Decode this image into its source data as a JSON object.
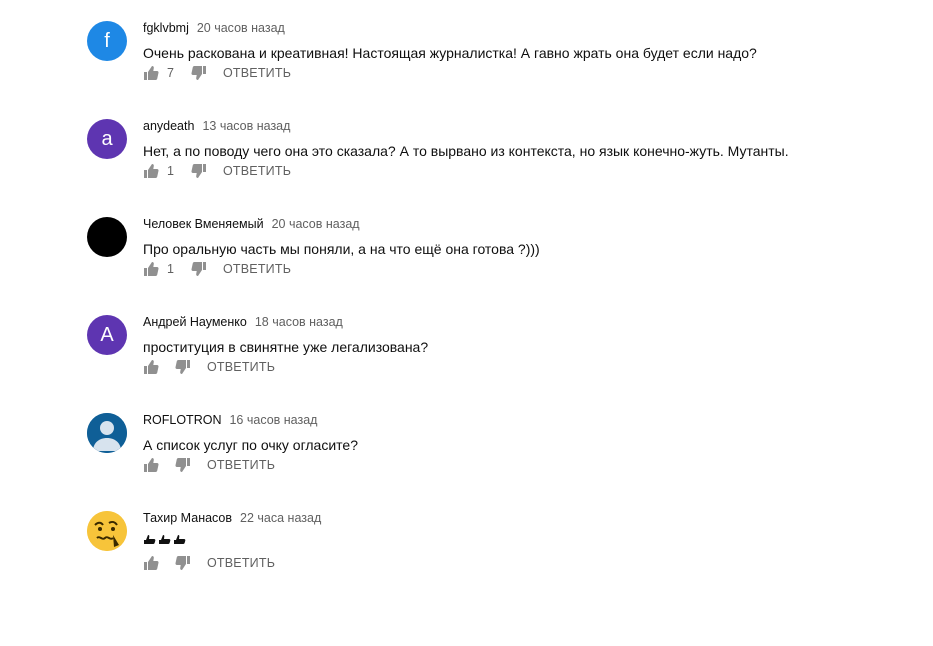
{
  "comments": [
    {
      "author": "fgklvbmj",
      "time": "20 часов назад",
      "text": "Очень раскована и креативная! Настоящая журналистка! А гавно жрать она будет если надо?",
      "likes": "7",
      "reply_label": "ОТВЕТИТЬ",
      "avatar": {
        "letter": "f",
        "color": "#1e88e5",
        "kind": "letter"
      }
    },
    {
      "author": "anydeath",
      "time": "13 часов назад",
      "text": "Нет, а по поводу чего она это сказала? А то вырвано из контекста, но язык конечно-жуть. Мутанты.",
      "likes": "1",
      "reply_label": "ОТВЕТИТЬ",
      "avatar": {
        "letter": "a",
        "color": "#5e35b1",
        "kind": "letter"
      }
    },
    {
      "author": "Человек Вменяемый",
      "time": "20 часов назад",
      "text": "Про оральную часть мы поняли, а на что ещё она готова ?)))",
      "likes": "1",
      "reply_label": "ОТВЕТИТЬ",
      "avatar": {
        "letter": "",
        "color": "#000000",
        "kind": "solid"
      }
    },
    {
      "author": "Андрей Науменко",
      "time": "18 часов назад",
      "text": "проституция в свинятне уже легализована?",
      "likes": "",
      "reply_label": "ОТВЕТИТЬ",
      "avatar": {
        "letter": "А",
        "color": "#5e35b1",
        "kind": "letter"
      }
    },
    {
      "author": "ROFLOTRON",
      "time": "16 часов назад",
      "text": "А список услуг по очку огласите?",
      "likes": "",
      "reply_label": "ОТВЕТИТЬ",
      "avatar": {
        "letter": "",
        "color": "#0f5f97",
        "kind": "default-user"
      }
    },
    {
      "author": "Тахир Манасов",
      "time": "22 часа назад",
      "text": "",
      "emoji_count": 3,
      "emoji_icon": "pointing-hand-icon",
      "likes": "",
      "reply_label": "ОТВЕТИТЬ",
      "avatar": {
        "letter": "",
        "color": "#f7c43a",
        "kind": "emoji-face"
      }
    }
  ],
  "icons": {
    "like": "thumb-up-icon",
    "dislike": "thumb-down-icon"
  }
}
